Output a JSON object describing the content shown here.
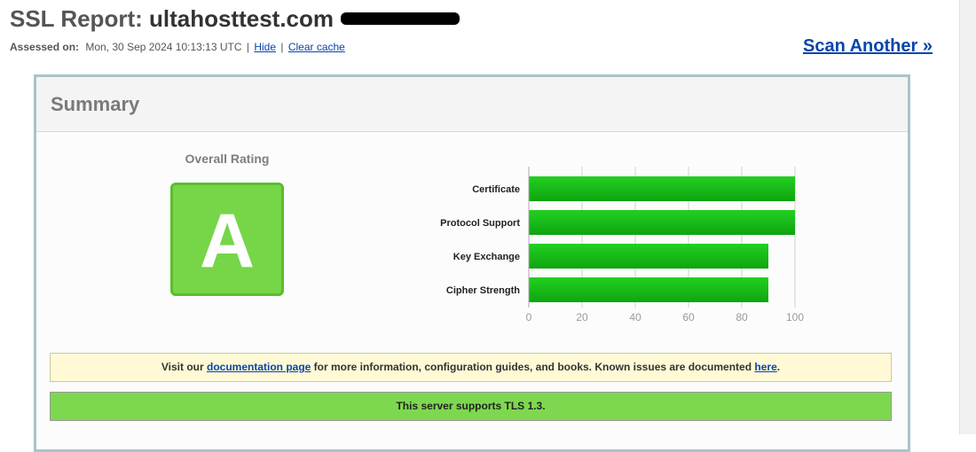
{
  "header": {
    "title_prefix": "SSL Report: ",
    "hostname": "ultahosttest.com",
    "assessed_label": "Assessed on:",
    "assessed_value": "Mon, 30 Sep 2024 10:13:13 UTC",
    "hide_link": "Hide",
    "clear_cache_link": "Clear cache",
    "separator": "|",
    "scan_another": "Scan Another »"
  },
  "summary": {
    "title": "Summary",
    "overall_rating_label": "Overall Rating",
    "grade": "A",
    "grade_color": "#77d548"
  },
  "chart_data": {
    "type": "bar",
    "orientation": "horizontal",
    "categories": [
      "Certificate",
      "Protocol Support",
      "Key Exchange",
      "Cipher Strength"
    ],
    "values": [
      100,
      100,
      90,
      90
    ],
    "xlim": [
      0,
      100
    ],
    "ticks": [
      0,
      20,
      40,
      60,
      80,
      100
    ],
    "bar_color": "#1cc21c",
    "grid": true
  },
  "notices": {
    "doc_prefix": "Visit our ",
    "doc_link": "documentation page",
    "doc_middle": " for more information, configuration guides, and books. Known issues are documented ",
    "doc_here": "here",
    "doc_suffix": ".",
    "tls_support": "This server supports TLS 1.3."
  }
}
